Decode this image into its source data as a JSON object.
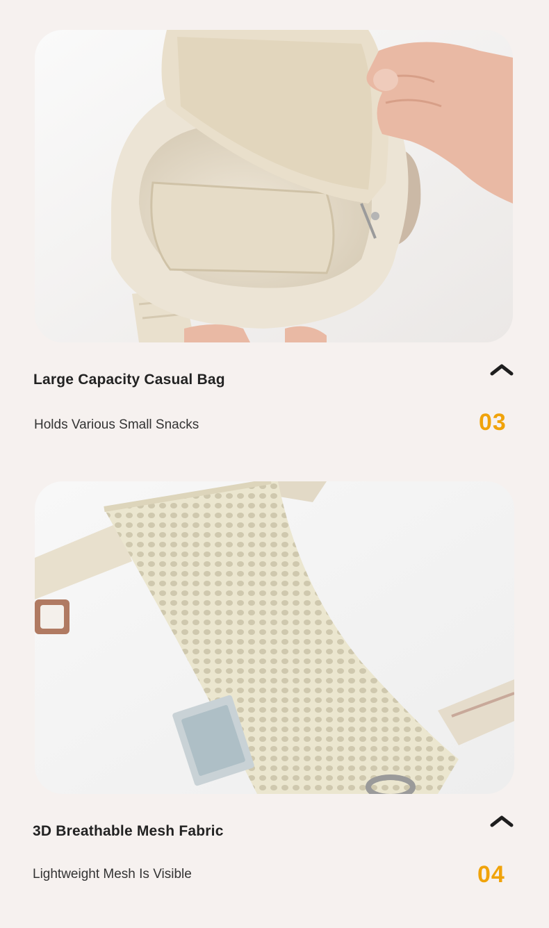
{
  "features": [
    {
      "title": "Large Capacity Casual Bag",
      "subtitle": "Holds Various Small Snacks",
      "index": "03",
      "image_icon": "open-bag-photo",
      "toggle_icon": "chevron-up-icon"
    },
    {
      "title": "3D Breathable Mesh Fabric",
      "subtitle": "Lightweight Mesh Is Visible",
      "index": "04",
      "image_icon": "mesh-strap-photo",
      "toggle_icon": "chevron-up-icon"
    }
  ],
  "colors": {
    "background": "#f6f1ef",
    "accent": "#f0a30a",
    "title": "#222222",
    "subtitle": "#333333"
  }
}
